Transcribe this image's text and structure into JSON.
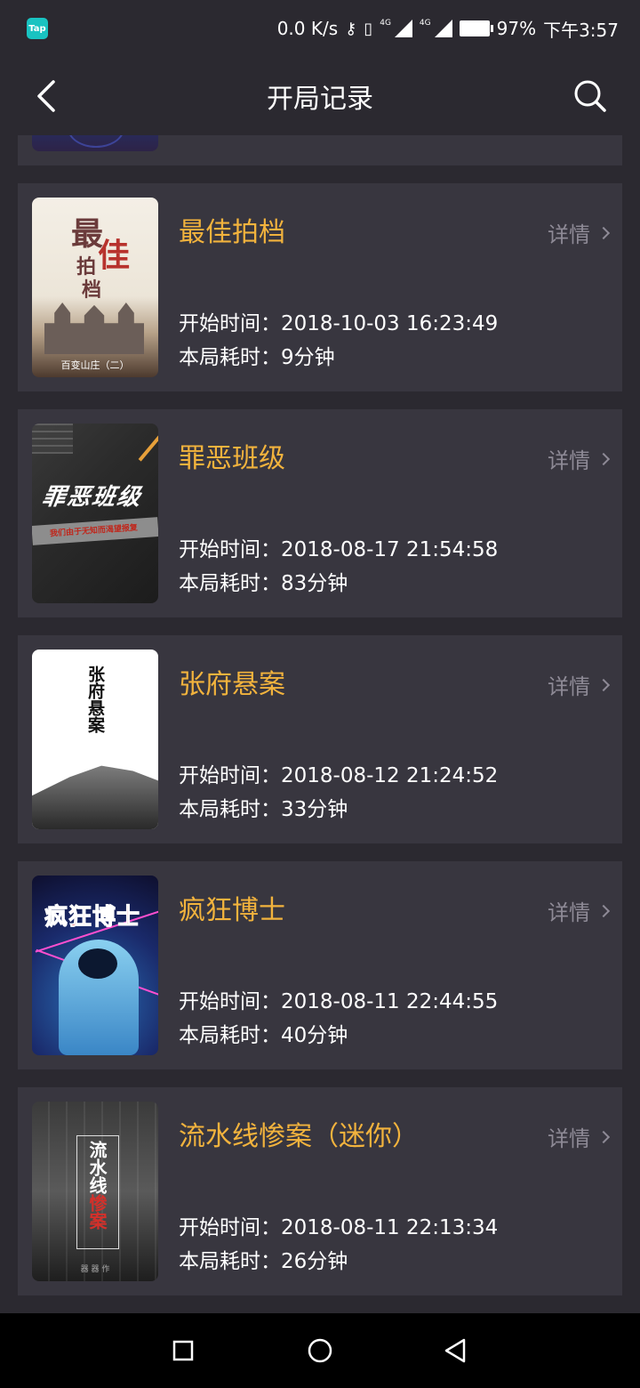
{
  "status": {
    "app_badge": "Tap",
    "net_speed": "0.0 K/s",
    "net1": "4G",
    "net2": "4G",
    "battery": "97%",
    "time": "下午3:57"
  },
  "header": {
    "title": "开局记录",
    "back_icon": "back-arrow-icon",
    "search_icon": "search-icon"
  },
  "records": [
    {
      "title": "最佳拍档",
      "start_label": "开始时间：",
      "start_time": "2018-10-03 16:23:49",
      "duration_label": "本局耗时：",
      "duration": "9分钟",
      "detail": "详情",
      "cover_text": "最佳拍档",
      "cover_caption": "百变山庄（二）"
    },
    {
      "title": "罪恶班级",
      "start_label": "开始时间：",
      "start_time": "2018-08-17 21:54:58",
      "duration_label": "本局耗时：",
      "duration": "83分钟",
      "detail": "详情",
      "cover_text": "罪恶班级",
      "cover_caption": "我们由于无知而渴望报复"
    },
    {
      "title": "张府悬案",
      "start_label": "开始时间：",
      "start_time": "2018-08-12 21:24:52",
      "duration_label": "本局耗时：",
      "duration": "33分钟",
      "detail": "详情",
      "cover_text": "张府悬案"
    },
    {
      "title": "疯狂博士",
      "start_label": "开始时间：",
      "start_time": "2018-08-11 22:44:55",
      "duration_label": "本局耗时：",
      "duration": "40分钟",
      "detail": "详情",
      "cover_text": "疯狂博士"
    },
    {
      "title": "流水线惨案（迷你）",
      "start_label": "开始时间：",
      "start_time": "2018-08-11 22:13:34",
      "duration_label": "本局耗时：",
      "duration": "26分钟",
      "detail": "详情",
      "cover_text_white": "流水线",
      "cover_text_red": "惨案",
      "cover_caption": "器 器 作"
    }
  ],
  "colors": {
    "background": "#2b2930",
    "card": "#38363f",
    "title_accent": "#f2b33d",
    "muted": "#8e8a96"
  }
}
